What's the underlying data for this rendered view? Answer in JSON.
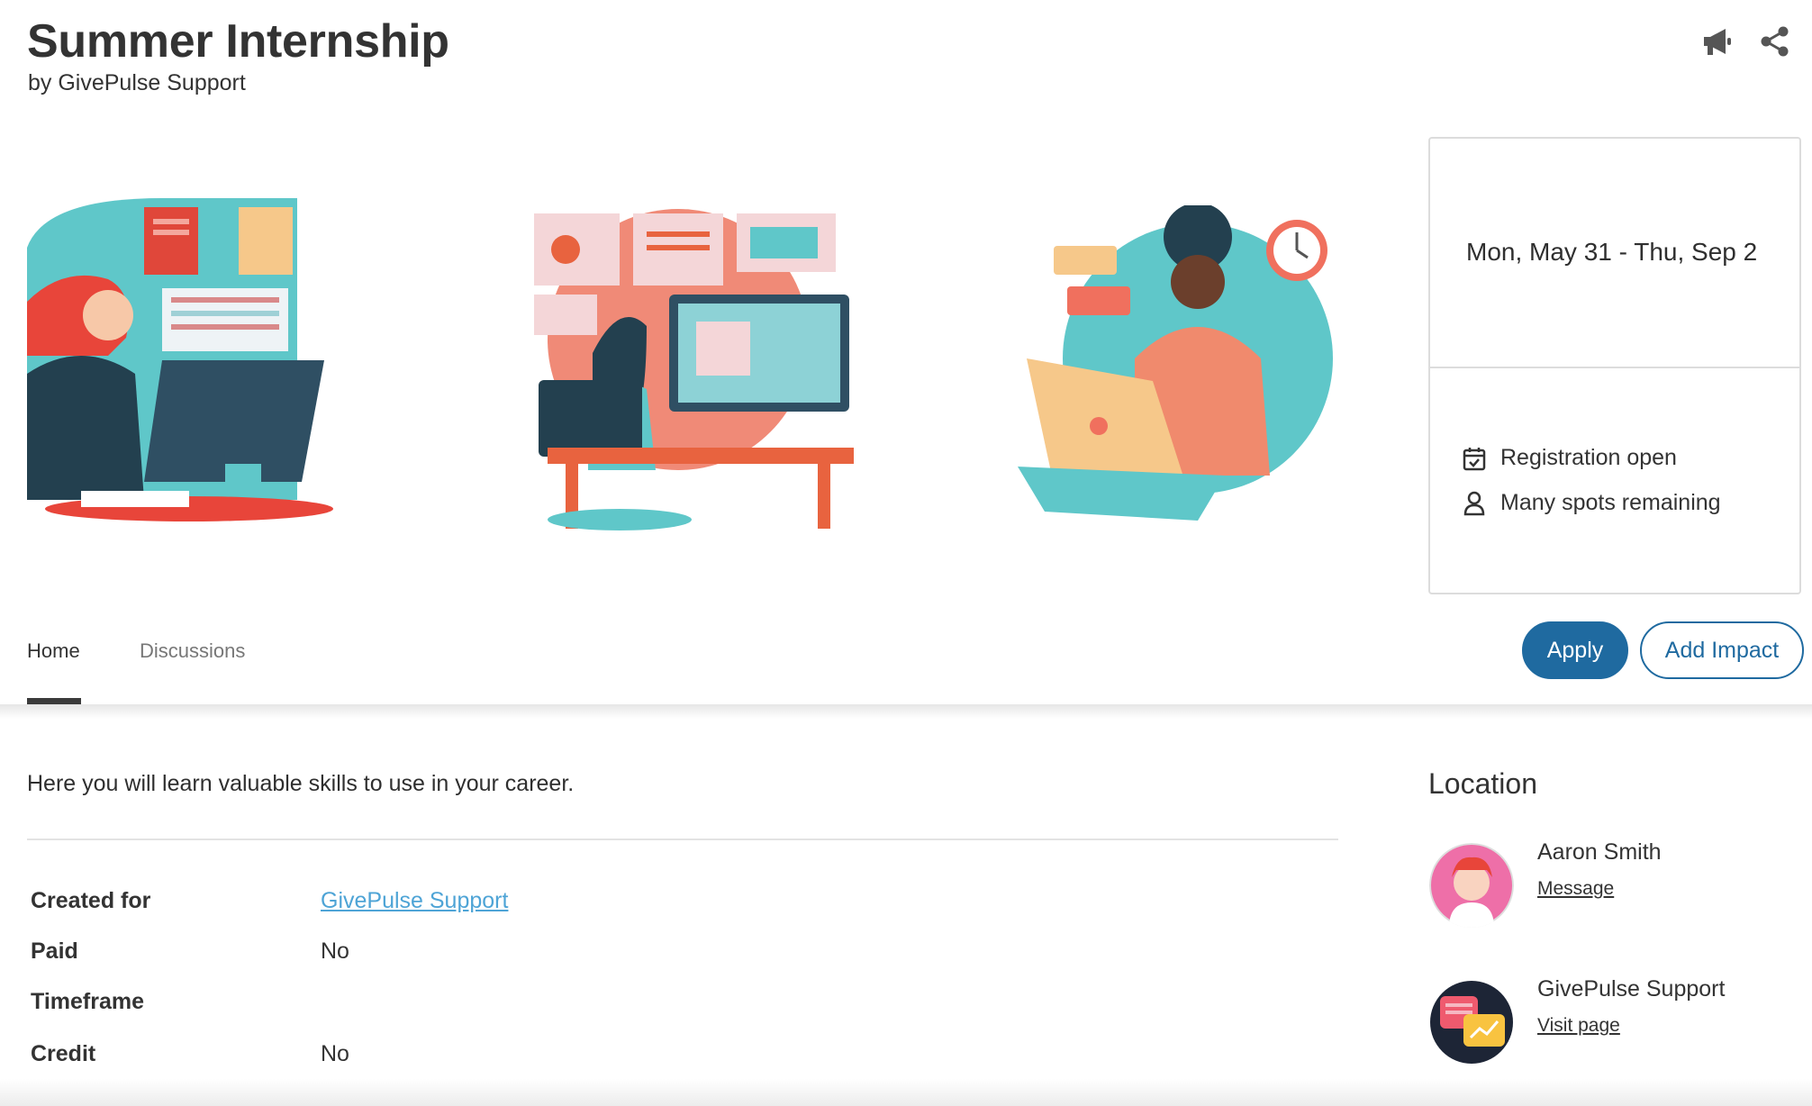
{
  "header": {
    "title": "Summer Internship",
    "subtitle": "by GivePulse Support"
  },
  "toolbar": {
    "announce_icon": "megaphone-icon",
    "share_icon": "share-icon"
  },
  "sidebar_card": {
    "date_range": "Mon, May 31 - Thu, Sep 2",
    "status": [
      {
        "icon": "calendar-check-icon",
        "label": "Registration open"
      },
      {
        "icon": "person-icon",
        "label": "Many spots remaining"
      }
    ]
  },
  "tabs": [
    {
      "label": "Home",
      "active": true
    },
    {
      "label": "Discussions",
      "active": false
    }
  ],
  "actions": {
    "apply_label": "Apply",
    "add_impact_label": "Add Impact"
  },
  "main": {
    "description": "Here you will learn valuable skills to use in your career.",
    "details": [
      {
        "label": "Created for",
        "value": "GivePulse Support",
        "is_link": true
      },
      {
        "label": "Paid",
        "value": "No"
      },
      {
        "label": "Timeframe",
        "value": ""
      },
      {
        "label": "Credit",
        "value": "No"
      }
    ]
  },
  "location": {
    "heading": "Location",
    "contacts": [
      {
        "name": "Aaron Smith",
        "link_label": "Message"
      },
      {
        "name": "GivePulse Support",
        "link_label": "Visit page"
      }
    ]
  },
  "colors": {
    "primary": "#1f6aa0",
    "link": "#4ea4d6",
    "teal": "#5fc7c9",
    "coral": "#f0705e"
  }
}
